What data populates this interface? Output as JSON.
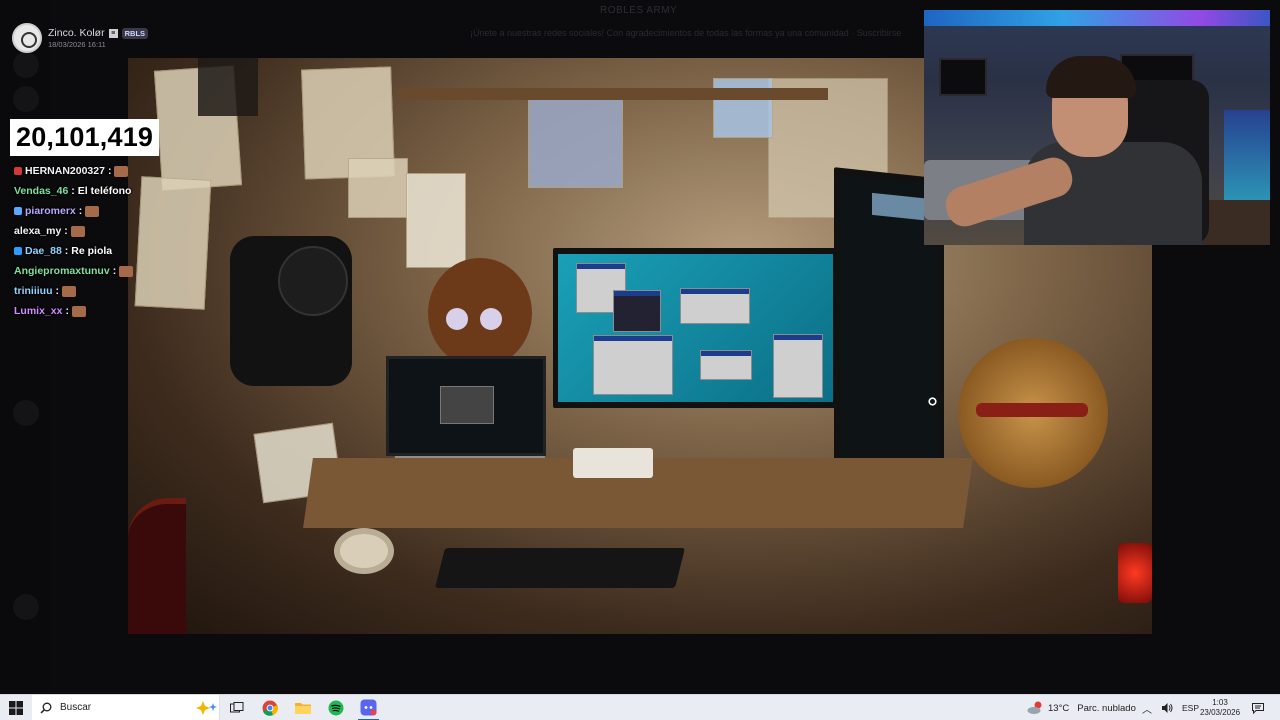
{
  "background_app": {
    "title": "ROBLES ARMY",
    "banner": "¡Únete a nuestras redes sociales! Con agradecimientos de todas las formas ya una comunidad · Suscribirse"
  },
  "stream": {
    "name": "Zinco. Kolør",
    "badge": "≡",
    "tag": "RBLS",
    "date": "18/03/2026 16:11"
  },
  "counter": "20,101,419",
  "chat": [
    {
      "user": "HERNAN200327",
      "sep": " :",
      "msg": "",
      "color": "#f2f2f2",
      "icon": "#d23a3a",
      "emote": true
    },
    {
      "user": "Vendas_46",
      "sep": " :",
      "msg": " El teléfono",
      "color": "#7ee0a0",
      "icon": "",
      "emote": false
    },
    {
      "user": "piaromerx",
      "sep": " :",
      "msg": "",
      "color": "#b9a8ff",
      "icon": "#5ba8ff",
      "emote": true
    },
    {
      "user": "alexa_my",
      "sep": " :",
      "msg": "",
      "color": "#f2f2f2",
      "icon": "",
      "emote": true
    },
    {
      "user": "Dae_88",
      "sep": " :",
      "msg": " Re piola",
      "color": "#8fd3ff",
      "icon": "#2e9cff",
      "emote": false
    },
    {
      "user": "Angiepromaxtunuv",
      "sep": " :",
      "msg": "",
      "color": "#7ee0a0",
      "icon": "",
      "emote": true
    },
    {
      "user": "triniiiuu",
      "sep": " :",
      "msg": "",
      "color": "#8fd3ff",
      "icon": "",
      "emote": true
    },
    {
      "user": "Lumix_xx",
      "sep": " :",
      "msg": "",
      "color": "#d28cff",
      "icon": "",
      "emote": true
    }
  ],
  "taskbar": {
    "search_label": "Buscar",
    "apps": [
      "task-view",
      "chrome",
      "file-explorer",
      "spotify",
      "discord"
    ],
    "weather_temp": "13°C",
    "weather_desc": "Parc. nublado",
    "language": "ESP",
    "time": "1:03",
    "date": "23/03/2026"
  },
  "colors": {
    "taskbar_bg": "#e9ecf3",
    "counter_bg": "#ffffff",
    "accent": "#1a63c9"
  }
}
